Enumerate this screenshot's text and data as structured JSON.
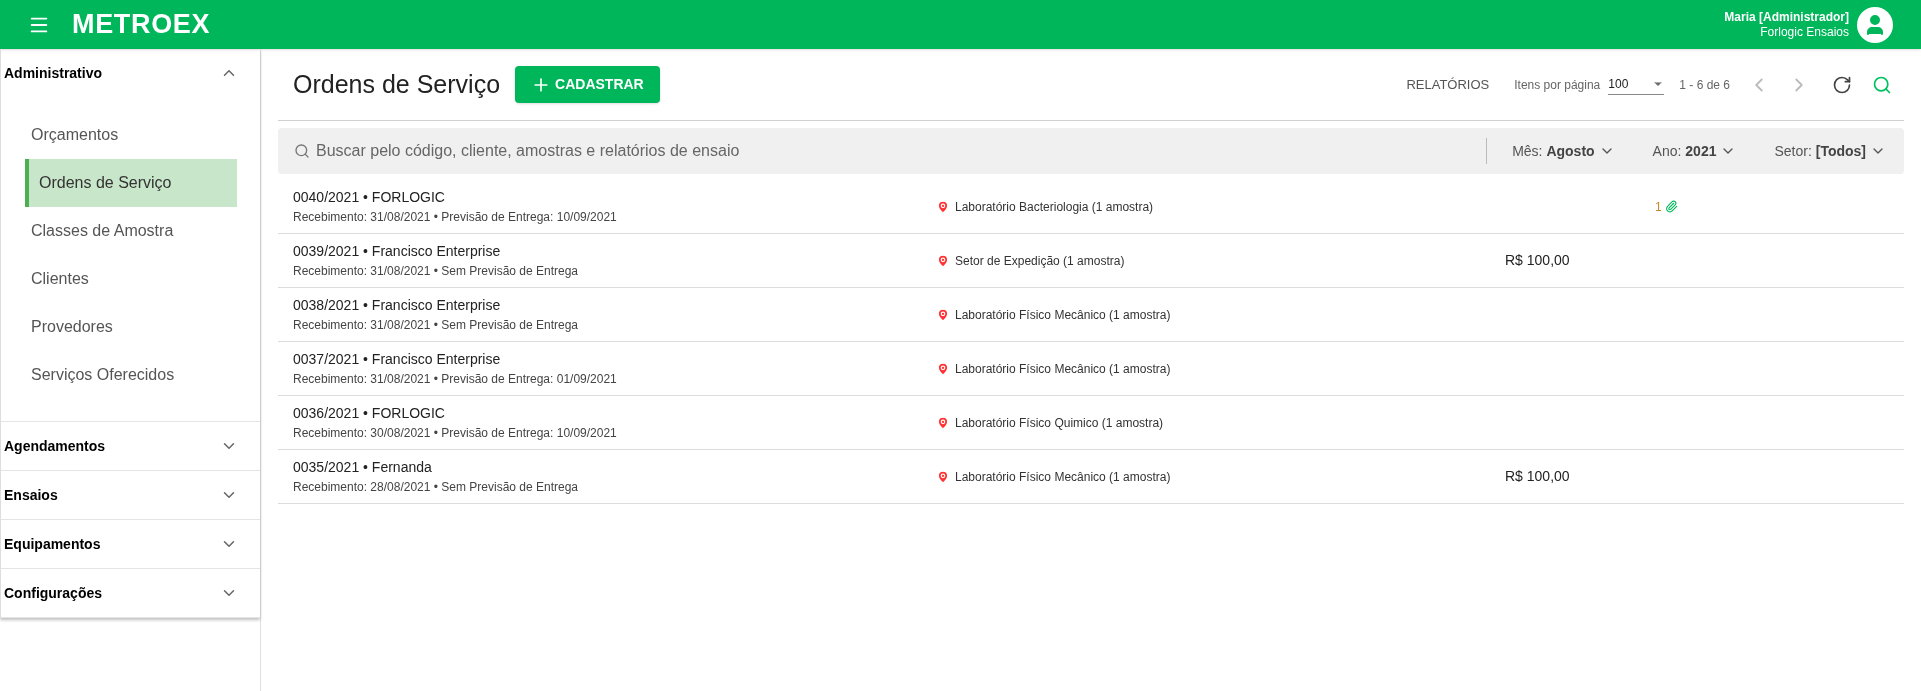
{
  "header": {
    "logo": "METROEX",
    "user_name": "Maria [Administrador]",
    "user_company": "Forlogic Ensaios"
  },
  "sidebar": {
    "sections": [
      {
        "label": "Administrativo",
        "expanded": true,
        "items": [
          {
            "label": "Orçamentos",
            "selected": false
          },
          {
            "label": "Ordens de Serviço",
            "selected": true
          },
          {
            "label": "Classes de Amostra",
            "selected": false
          },
          {
            "label": "Clientes",
            "selected": false
          },
          {
            "label": "Provedores",
            "selected": false
          },
          {
            "label": "Serviços Oferecidos",
            "selected": false
          }
        ]
      },
      {
        "label": "Agendamentos",
        "expanded": false
      },
      {
        "label": "Ensaios",
        "expanded": false
      },
      {
        "label": "Equipamentos",
        "expanded": false
      },
      {
        "label": "Configurações",
        "expanded": false
      }
    ]
  },
  "page": {
    "title": "Ordens de Serviço",
    "add_button": "CADASTRAR",
    "reports_link": "RELATÓRIOS",
    "per_page_label": "Itens por página",
    "per_page_value": "100",
    "range": "1 - 6 de 6"
  },
  "search": {
    "placeholder": "Buscar pelo código, cliente, amostras e relatórios de ensaio"
  },
  "filters": [
    {
      "label": "Mês:",
      "value": "Agosto"
    },
    {
      "label": "Ano:",
      "value": "2021"
    },
    {
      "label": "Setor:",
      "value": "[Todos]"
    }
  ],
  "orders": [
    {
      "title": "0040/2021 • FORLOGIC",
      "dates": "Recebimento: 31/08/2021 • Previsão de Entrega: 10/09/2021",
      "location": "Laboratório Bacteriologia (1 amostra)",
      "attachments": "1"
    },
    {
      "title": "0039/2021 • Francisco Enterprise",
      "dates": "Recebimento: 31/08/2021 • Sem Previsão de Entrega",
      "location": "Setor de Expedição (1 amostra)",
      "value": "R$ 100,00"
    },
    {
      "title": "0038/2021 • Francisco Enterprise",
      "dates": "Recebimento: 31/08/2021 • Sem Previsão de Entrega",
      "location": "Laboratório Físico Mecânico (1 amostra)"
    },
    {
      "title": "0037/2021 • Francisco Enterprise",
      "dates": "Recebimento: 31/08/2021 • Previsão de Entrega: 01/09/2021",
      "location": "Laboratório Físico Mecânico (1 amostra)"
    },
    {
      "title": "0036/2021 • FORLOGIC",
      "dates": "Recebimento: 30/08/2021 • Previsão de Entrega: 10/09/2021",
      "location": "Laboratório Físico Quimico (1 amostra)"
    },
    {
      "title": "0035/2021 • Fernanda",
      "dates": "Recebimento: 28/08/2021 • Sem Previsão de Entrega",
      "location": "Laboratório Físico Mecânico (1 amostra)",
      "value": "R$ 100,00"
    }
  ]
}
